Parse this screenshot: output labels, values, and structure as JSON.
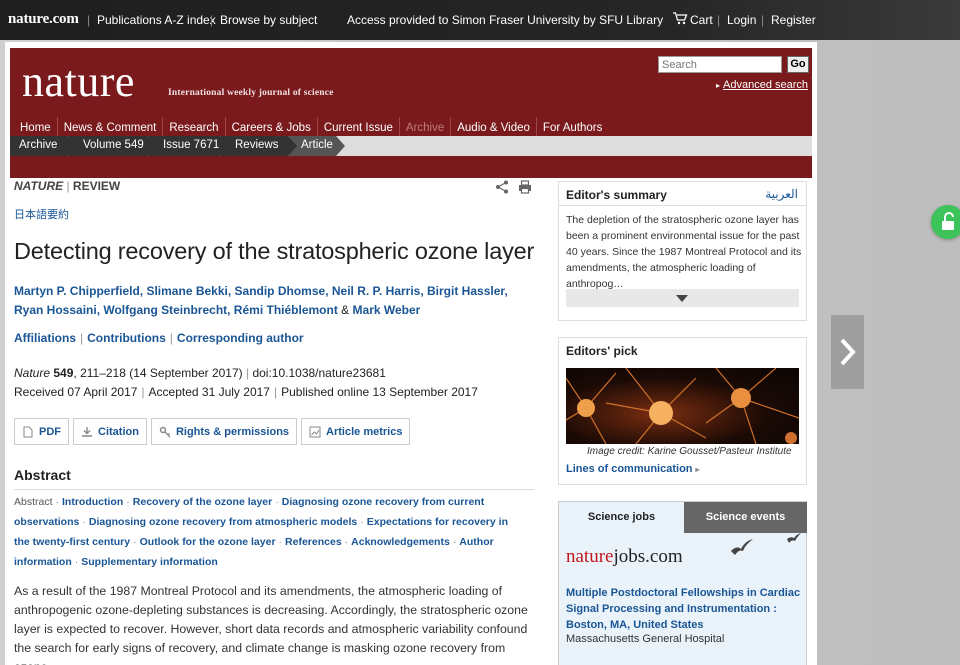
{
  "globalbar": {
    "logo": "nature.com",
    "links": [
      "Publications A-Z index",
      "Browse by subject"
    ],
    "access": "Access provided to Simon Fraser University by SFU Library",
    "cart": "Cart",
    "login": "Login",
    "register": "Register"
  },
  "masthead": {
    "wordmark": "nature",
    "tagline": "International weekly journal of science",
    "search_placeholder": "Search",
    "go": "Go",
    "advanced": "Advanced search",
    "nav": [
      "Home",
      "News & Comment",
      "Research",
      "Careers & Jobs",
      "Current Issue",
      "Archive",
      "Audio & Video",
      "For Authors"
    ]
  },
  "breadcrumbs": [
    "Archive",
    "Volume 549",
    "Issue 7671",
    "Reviews",
    "Article"
  ],
  "article": {
    "journal": "NATURE",
    "type": "REVIEW",
    "japanese": "日本語要約",
    "title": "Detecting recovery of the stratospheric ozone layer",
    "authors_line1": "Martyn P. Chipperfield, Slimane Bekki, Sandip Dhomse, Neil R. P. Harris, Birgit Hassler,",
    "authors_line2": "Ryan Hossaini, Wolfgang Steinbrecht, Rémi Thiéblemont",
    "authors_amp": "&",
    "authors_last": "Mark Weber",
    "affiliations": "Affiliations",
    "contributions": "Contributions",
    "corresponding": "Corresponding author",
    "cite_journal": "Nature",
    "cite_volume": "549",
    "cite_rest": ", 211–218  (14 September 2017)",
    "doi": "doi:10.1038/nature23681",
    "received": "Received  07 April 2017",
    "accepted": "Accepted  31 July 2017",
    "published": "Published online  13 September 2017",
    "tools": [
      "PDF",
      "Citation",
      "Rights & permissions",
      "Article metrics"
    ],
    "abstract_heading": "Abstract",
    "toc_lead": "Abstract",
    "toc_items": [
      "Introduction",
      "Recovery of the ozone layer",
      "Diagnosing ozone recovery from current observations",
      "Diagnosing ozone recovery from atmospheric models",
      "Expectations for recovery in the twenty-first century",
      "Outlook for the ozone layer",
      "References",
      "Acknowledgements",
      "Author information",
      "Supplementary information"
    ],
    "abstract_text": "As a result of the 1987 Montreal Protocol and its amendments, the atmospheric loading of anthropogenic ozone-depleting substances is decreasing. Accordingly, the stratospheric ozone layer is expected to recover. However, short data records and atmospheric variability confound the search for early signs of recovery, and climate change is masking ozone recovery from ozone-"
  },
  "editors_summary": {
    "heading": "Editor's summary",
    "arabic": "العربية",
    "text": "The depletion of the stratospheric ozone layer has been a prominent environmental issue for the past 40 years. Since the 1987 Montreal Protocol and its amendments, the atmospheric loading of anthropog…"
  },
  "editors_pick": {
    "heading": "Editors' pick",
    "credit": "Image credit: Karine Gousset/Pasteur Institute",
    "link": "Lines of communication"
  },
  "jobs": {
    "tab_jobs": "Science jobs",
    "tab_events": "Science events",
    "logo_a": "nature",
    "logo_b": "jobs.com",
    "job_title": "Multiple Postdoctoral Fellowships in Cardiac Signal Processing and Instrumentation : Boston, MA, United States",
    "job_org": "Massachusetts General Hospital"
  },
  "colors": {
    "masthead": "#7a1a1c",
    "link": "#1a5695",
    "lock": "#3cc45a"
  }
}
